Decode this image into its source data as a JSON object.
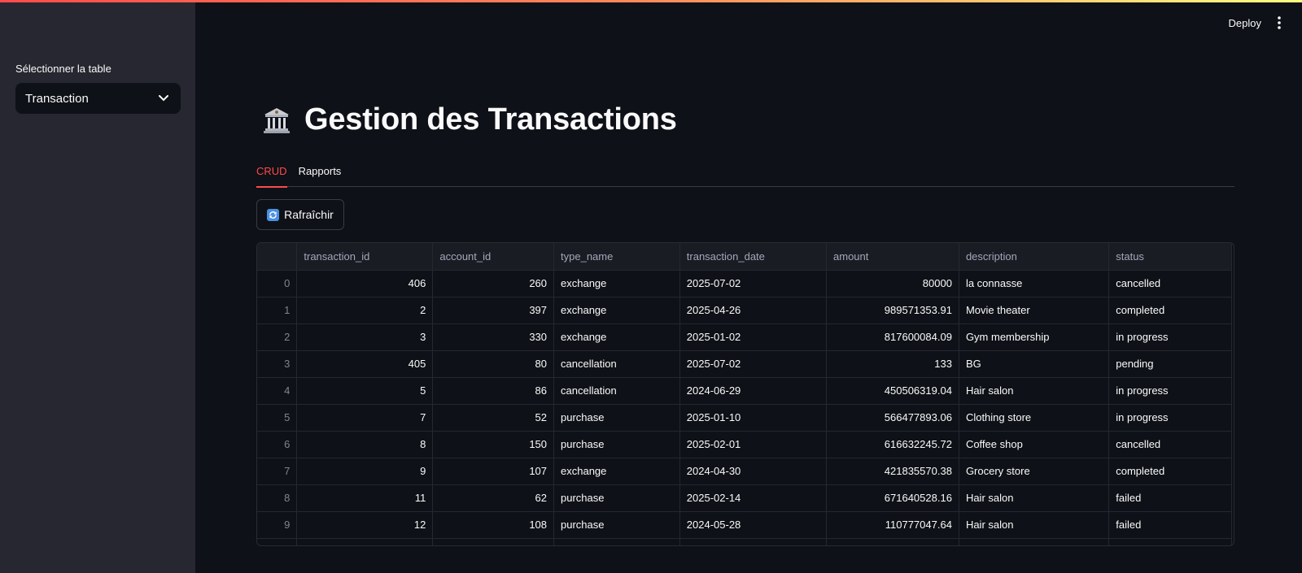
{
  "header": {
    "deploy_label": "Deploy"
  },
  "sidebar": {
    "select_label": "Sélectionner la table",
    "select_value": "Transaction"
  },
  "main": {
    "title": "Gestion des Transactions",
    "title_icon": "bank-icon",
    "tabs": [
      {
        "label": "CRUD",
        "active": true
      },
      {
        "label": "Rapports",
        "active": false
      }
    ],
    "refresh_label": "Rafraîchir"
  },
  "table": {
    "columns": [
      "transaction_id",
      "account_id",
      "type_name",
      "transaction_date",
      "amount",
      "description",
      "status"
    ],
    "rows": [
      [
        "0",
        "406",
        "260",
        "exchange",
        "2025-07-02",
        "80000",
        "la connasse",
        "cancelled"
      ],
      [
        "1",
        "2",
        "397",
        "exchange",
        "2025-04-26",
        "989571353.91",
        "Movie theater",
        "completed"
      ],
      [
        "2",
        "3",
        "330",
        "exchange",
        "2025-01-02",
        "817600084.09",
        "Gym membership",
        "in progress"
      ],
      [
        "3",
        "405",
        "80",
        "cancellation",
        "2025-07-02",
        "133",
        "BG",
        "pending"
      ],
      [
        "4",
        "5",
        "86",
        "cancellation",
        "2024-06-29",
        "450506319.04",
        "Hair salon",
        "in progress"
      ],
      [
        "5",
        "7",
        "52",
        "purchase",
        "2025-01-10",
        "566477893.06",
        "Clothing store",
        "in progress"
      ],
      [
        "6",
        "8",
        "150",
        "purchase",
        "2025-02-01",
        "616632245.72",
        "Coffee shop",
        "cancelled"
      ],
      [
        "7",
        "9",
        "107",
        "exchange",
        "2024-04-30",
        "421835570.38",
        "Grocery store",
        "completed"
      ],
      [
        "8",
        "11",
        "62",
        "purchase",
        "2025-02-14",
        "671640528.16",
        "Hair salon",
        "failed"
      ],
      [
        "9",
        "12",
        "108",
        "purchase",
        "2024-05-28",
        "110777047.64",
        "Hair salon",
        "failed"
      ]
    ]
  },
  "colors": {
    "accent": "#ff4b4b",
    "background": "#0e1117",
    "sidebar": "#262730"
  }
}
